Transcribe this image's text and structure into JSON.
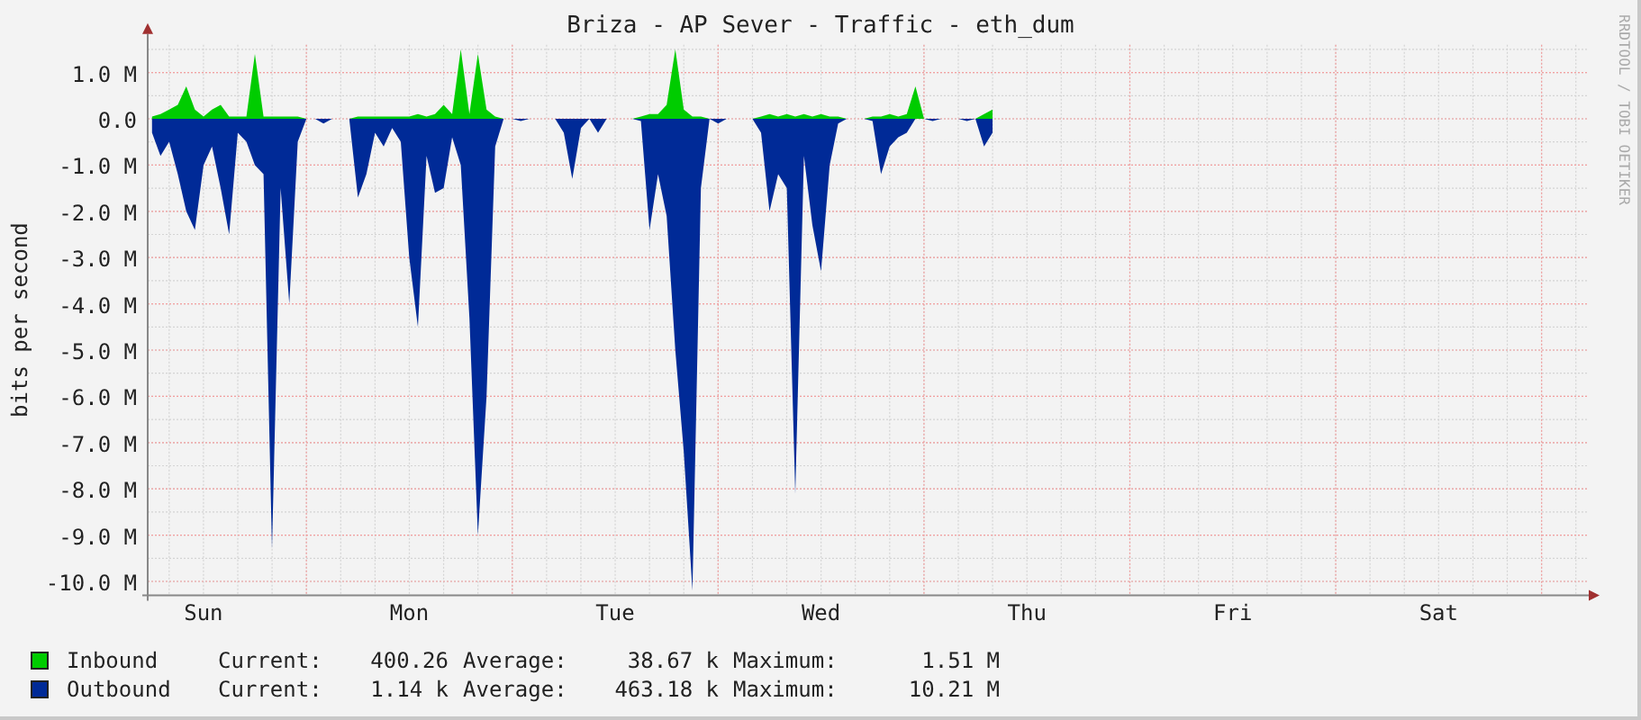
{
  "title": "Briza - AP Sever - Traffic - eth_dum",
  "credit": "RRDTOOL / TOBI OETIKER",
  "chart_data": {
    "type": "area",
    "grid": true,
    "ylabel": "bits per second",
    "ylim": [
      -10.3,
      1.6
    ],
    "yticks": [
      {
        "value": 1,
        "label": "1.0 M"
      },
      {
        "value": 0,
        "label": "0.0"
      },
      {
        "value": -1,
        "label": "-1.0 M"
      },
      {
        "value": -2,
        "label": "-2.0 M"
      },
      {
        "value": -3,
        "label": "-3.0 M"
      },
      {
        "value": -4,
        "label": "-4.0 M"
      },
      {
        "value": -5,
        "label": "-5.0 M"
      },
      {
        "value": -6,
        "label": "-6.0 M"
      },
      {
        "value": -7,
        "label": "-7.0 M"
      },
      {
        "value": -8,
        "label": "-8.0 M"
      },
      {
        "value": -9,
        "label": "-9.0 M"
      },
      {
        "value": -10,
        "label": "-10.0 M"
      }
    ],
    "categories": [
      null,
      null,
      null,
      null,
      null,
      null,
      "Sun",
      null,
      null,
      null,
      null,
      null,
      null,
      null,
      null,
      null,
      null,
      null,
      null,
      null,
      null,
      null,
      null,
      null,
      null,
      null,
      null,
      null,
      null,
      null,
      "Mon",
      null,
      null,
      null,
      null,
      null,
      null,
      null,
      null,
      null,
      null,
      null,
      null,
      null,
      null,
      null,
      null,
      null,
      null,
      null,
      null,
      null,
      null,
      null,
      "Tue",
      null,
      null,
      null,
      null,
      null,
      null,
      null,
      null,
      null,
      null,
      null,
      null,
      null,
      null,
      null,
      null,
      null,
      null,
      null,
      null,
      null,
      null,
      null,
      "Wed",
      null,
      null,
      null,
      null,
      null,
      null,
      null,
      null,
      null,
      null,
      null,
      null,
      null,
      null,
      null,
      null,
      null,
      null,
      null,
      null,
      null,
      null,
      null,
      "Thu",
      null,
      null,
      null,
      null,
      null,
      null,
      null,
      null,
      null,
      null,
      null,
      null,
      null,
      null,
      null,
      null,
      null,
      null,
      null,
      null,
      null,
      null,
      null,
      "Fri",
      null,
      null,
      null,
      null,
      null,
      null,
      null,
      null,
      null,
      null,
      null,
      null,
      null,
      null,
      null,
      null,
      null,
      null,
      null,
      null,
      null,
      null,
      null,
      "Sat",
      null,
      null,
      null,
      null,
      null,
      null,
      null,
      null,
      null,
      null,
      null,
      null,
      null,
      null,
      null,
      null,
      null
    ],
    "series": [
      {
        "name": "Inbound",
        "color": "#00cc00",
        "values": [
          0.05,
          0.1,
          0.2,
          0.3,
          0.7,
          0.2,
          0.05,
          0.2,
          0.3,
          0.05,
          0.05,
          0.05,
          1.4,
          0.05,
          0.05,
          0.05,
          0.05,
          0.05,
          0,
          0,
          0,
          0,
          0,
          0,
          0.05,
          0.05,
          0.05,
          0.05,
          0.05,
          0.05,
          0.05,
          0.1,
          0.05,
          0.1,
          0.3,
          0.1,
          1.5,
          0.1,
          1.4,
          0.2,
          0.05,
          0,
          0,
          0,
          0,
          0,
          0,
          0,
          0,
          0,
          0,
          0,
          0,
          0,
          0,
          0,
          0,
          0.05,
          0.1,
          0.1,
          0.3,
          1.5,
          0.2,
          0.05,
          0.05,
          0,
          0,
          0,
          0,
          0,
          0,
          0.05,
          0.1,
          0.05,
          0.1,
          0.05,
          0.1,
          0.05,
          0.1,
          0.05,
          0.05,
          0,
          0,
          0,
          0.05,
          0.05,
          0.1,
          0.05,
          0.1,
          0.7,
          0,
          0,
          0,
          0,
          0,
          0,
          0,
          0.1,
          0.2,
          null,
          null,
          null,
          null,
          null,
          null,
          null,
          null,
          null,
          null,
          null,
          null,
          null,
          null,
          null,
          null,
          null,
          null,
          null,
          null,
          null,
          null,
          null,
          null,
          null,
          null,
          null,
          null,
          null,
          null,
          null,
          null,
          null,
          null,
          null,
          null,
          null,
          null,
          null,
          null,
          null,
          null,
          null,
          null,
          null,
          null,
          null,
          null,
          null,
          null,
          null,
          null,
          null,
          null,
          null,
          null,
          null,
          null,
          null,
          null,
          null,
          null,
          null,
          null,
          null,
          null,
          null,
          null,
          null
        ]
      },
      {
        "name": "Outbound",
        "color": "#002a97",
        "values": [
          -0.3,
          -0.8,
          -0.5,
          -1.2,
          -2.0,
          -2.4,
          -1.0,
          -0.6,
          -1.5,
          -2.5,
          -0.3,
          -0.5,
          -1.0,
          -1.2,
          -9.3,
          -1.5,
          -4.0,
          -0.5,
          0,
          0,
          -0.1,
          0,
          0,
          0,
          -1.7,
          -1.2,
          -0.3,
          -0.6,
          -0.2,
          -0.5,
          -3.0,
          -4.5,
          -0.8,
          -1.6,
          -1.5,
          -0.4,
          -1.0,
          -4.3,
          -9.0,
          -6.0,
          -0.6,
          0,
          0,
          -0.05,
          0,
          0,
          0,
          0,
          -0.3,
          -1.3,
          -0.2,
          0,
          -0.3,
          0,
          0,
          0,
          0,
          -0.05,
          -2.4,
          -1.2,
          -2.1,
          -5.0,
          -7.2,
          -10.2,
          -1.5,
          0,
          -0.1,
          0,
          0,
          0,
          0,
          -0.3,
          -2.0,
          -1.2,
          -1.5,
          -8.1,
          -0.8,
          -2.3,
          -3.3,
          -1.0,
          -0.1,
          0,
          0,
          0,
          -0.05,
          -1.2,
          -0.6,
          -0.4,
          -0.3,
          0,
          0,
          -0.05,
          0,
          0,
          0,
          -0.05,
          0,
          -0.6,
          -0.3,
          null,
          null,
          null,
          null,
          null,
          null,
          null,
          null,
          null,
          null,
          null,
          null,
          null,
          null,
          null,
          null,
          null,
          null,
          null,
          null,
          null,
          null,
          null,
          null,
          null,
          null,
          null,
          null,
          null,
          null,
          null,
          null,
          null,
          null,
          null,
          null,
          null,
          null,
          null,
          null,
          null,
          null,
          null,
          null,
          null,
          null,
          null,
          null,
          null,
          null,
          null,
          null,
          null,
          null,
          null,
          null,
          null,
          null,
          null,
          null,
          null,
          null,
          null,
          null,
          null,
          null,
          null,
          null,
          null
        ]
      }
    ]
  },
  "legend": [
    {
      "current_label": "Current:",
      "current": "400.26",
      "average_label": "Average:",
      "average": "38.67 k",
      "maximum_label": "Maximum:",
      "maximum": "1.51 M"
    },
    {
      "current_label": "Current:",
      "current": "1.14 k",
      "average_label": "Average:",
      "average": "463.18 k",
      "maximum_label": "Maximum:",
      "maximum": "10.21 M"
    }
  ]
}
